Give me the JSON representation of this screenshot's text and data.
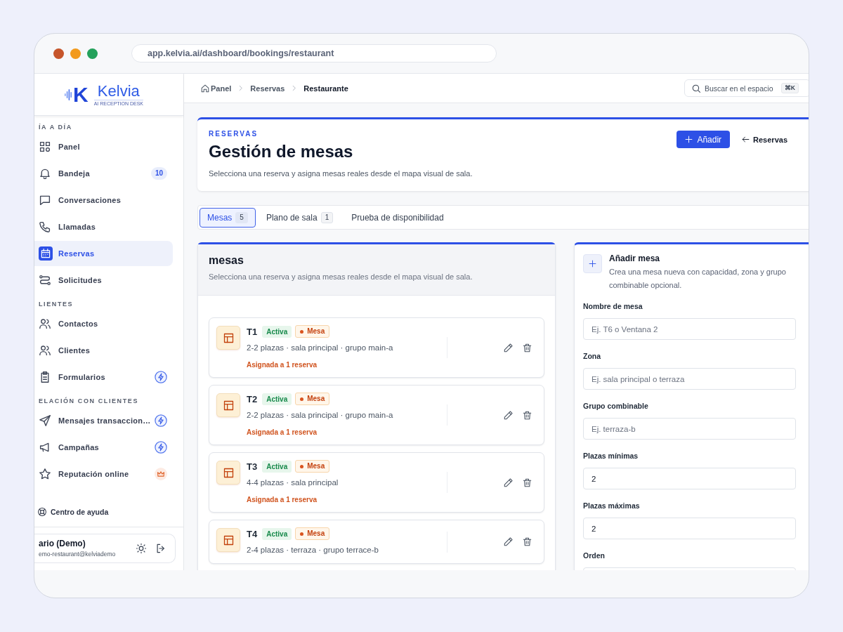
{
  "browser": {
    "url": "app.kelvia.ai/dashboard/bookings/restaurant"
  },
  "sidebar": {
    "logo": {
      "monogram": "K",
      "name": "Kelvia",
      "tagline": "AI RECEPTION DESK"
    },
    "sections": [
      {
        "title": "ÍA A DÍA",
        "items": [
          {
            "label": "Panel",
            "kind": "plain",
            "selected": false
          },
          {
            "label": "Bandeja",
            "kind": "counter",
            "badge": "10",
            "selected": false
          },
          {
            "label": "Conversaciones",
            "kind": "plain",
            "selected": false
          },
          {
            "label": "Llamadas",
            "kind": "plain",
            "selected": false
          },
          {
            "label": "Reservas",
            "kind": "plain",
            "selected": true
          },
          {
            "label": "Solicitudes",
            "kind": "plain",
            "selected": false
          }
        ]
      },
      {
        "title": "LIENTES",
        "items": [
          {
            "label": "Contactos",
            "kind": "plain",
            "selected": false
          },
          {
            "label": "Clientes",
            "kind": "plain",
            "selected": false
          },
          {
            "label": "Formularios",
            "kind": "automation",
            "selected": false
          }
        ]
      },
      {
        "title": "ELACIÓN CON CLIENTES",
        "items": [
          {
            "label": "Mensajes transaccion…",
            "kind": "automation",
            "selected": false
          },
          {
            "label": "Campañas",
            "kind": "automation",
            "selected": false
          },
          {
            "label": "Reputación online",
            "kind": "premium",
            "selected": false
          }
        ]
      }
    ],
    "help": "Centro de ayuda",
    "user": {
      "name": "ario (Demo)",
      "email": "emo-restaurant@kelviademo"
    }
  },
  "header": {
    "breadcrumb": [
      {
        "label": "Panel",
        "current": false
      },
      {
        "label": "Reservas",
        "current": false
      },
      {
        "label": "Restaurante",
        "current": true
      }
    ],
    "search": {
      "placeholder": "Buscar en el espacio",
      "shortcut": "⌘K"
    }
  },
  "page": {
    "eyebrow": "RESERVAS",
    "title": "Gestión de mesas",
    "subtitle": "Selecciona una reserva y asigna mesas reales desde el mapa visual de sala.",
    "actions": [
      {
        "label": "Añadir",
        "kind": "primary"
      },
      {
        "label": "Reservas",
        "kind": "back"
      }
    ]
  },
  "tabs": [
    {
      "label": "Mesas",
      "count": "5",
      "selected": true
    },
    {
      "label": "Plano de sala",
      "count": "1",
      "selected": false
    },
    {
      "label": "Prueba de disponibilidad",
      "selected": false
    }
  ],
  "tables_panel": {
    "title": "mesas",
    "subtitle": "Selecciona una reserva y asigna mesas reales desde el mapa visual de sala.",
    "tables": [
      {
        "name": "T1",
        "status": "Activa",
        "type": "Mesa",
        "details": "2-2 plazas · sala principal · grupo main-a",
        "assignment": "Asignada a 1 reserva"
      },
      {
        "name": "T2",
        "status": "Activa",
        "type": "Mesa",
        "details": "2-2 plazas · sala principal · grupo main-a",
        "assignment": "Asignada a 1 reserva"
      },
      {
        "name": "T3",
        "status": "Activa",
        "type": "Mesa",
        "details": "4-4 plazas · sala principal",
        "assignment": "Asignada a 1 reserva"
      },
      {
        "name": "T4",
        "status": "Activa",
        "type": "Mesa",
        "details": "2-4 plazas · terraza · grupo terrace-b"
      }
    ]
  },
  "add_form": {
    "title": "Añadir mesa",
    "description": "Crea una mesa nueva con capacidad, zona y grupo combinable opcional.",
    "fields": [
      {
        "label": "Nombre de mesa",
        "placeholder": "Ej. T6 o Ventana 2"
      },
      {
        "label": "Zona",
        "placeholder": "Ej. sala principal o terraza"
      },
      {
        "label": "Grupo combinable",
        "placeholder": "Ej. terraza-b"
      },
      {
        "label": "Plazas mínimas",
        "value": "2"
      },
      {
        "label": "Plazas máximas",
        "value": "2"
      },
      {
        "label": "Orden"
      }
    ]
  }
}
